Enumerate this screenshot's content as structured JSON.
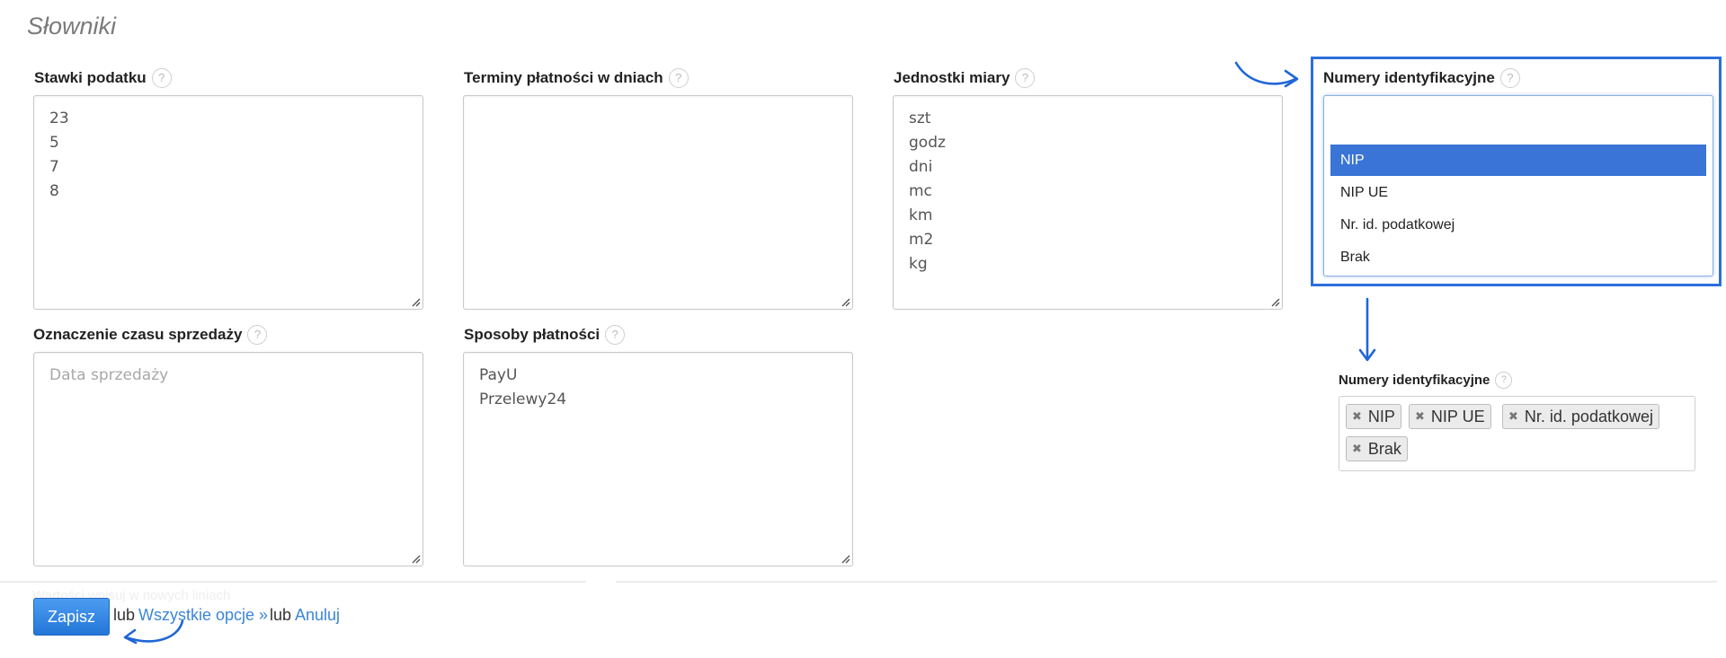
{
  "page": {
    "title": "Słowniki"
  },
  "help_glyph": "?",
  "fields": {
    "tax_rates": {
      "label": "Stawki podatku",
      "lines": [
        "23",
        "5",
        "7",
        "8"
      ]
    },
    "payment_terms": {
      "label": "Terminy płatności w dniach",
      "lines": []
    },
    "units": {
      "label": "Jednostki miary",
      "lines": [
        "szt",
        "godz",
        "dni",
        "mc",
        "km",
        "m2",
        "kg"
      ]
    },
    "sale_time": {
      "label": "Oznaczenie czasu sprzedaży",
      "placeholder": "Data sprzedaży"
    },
    "payment_methods": {
      "label": "Sposoby płatności",
      "lines": [
        "PayU",
        "Przelewy24"
      ]
    }
  },
  "id_numbers_select": {
    "label": "Numery identyfikacyjne",
    "options": [
      "NIP",
      "NIP UE",
      "Nr. id. podatkowej",
      "Brak"
    ],
    "selected": "NIP"
  },
  "id_numbers_tags": {
    "label": "Numery identyfikacyjne",
    "remove_glyph": "✖",
    "tags": [
      "NIP",
      "NIP UE",
      "Nr. id. podatkowej",
      "Brak"
    ]
  },
  "footer": {
    "hint": "Wartości wpisuj w nowych liniach",
    "save_label": "Zapisz",
    "or_1": "lub",
    "all_options_label": "Wszystkie opcje »",
    "or_2": "lub",
    "cancel_label": "Anuluj"
  },
  "colors": {
    "accent": "#2b6fdc",
    "selected_option": "#3a74d6",
    "link": "#3a86d6",
    "save_button": "#2f86e6"
  }
}
